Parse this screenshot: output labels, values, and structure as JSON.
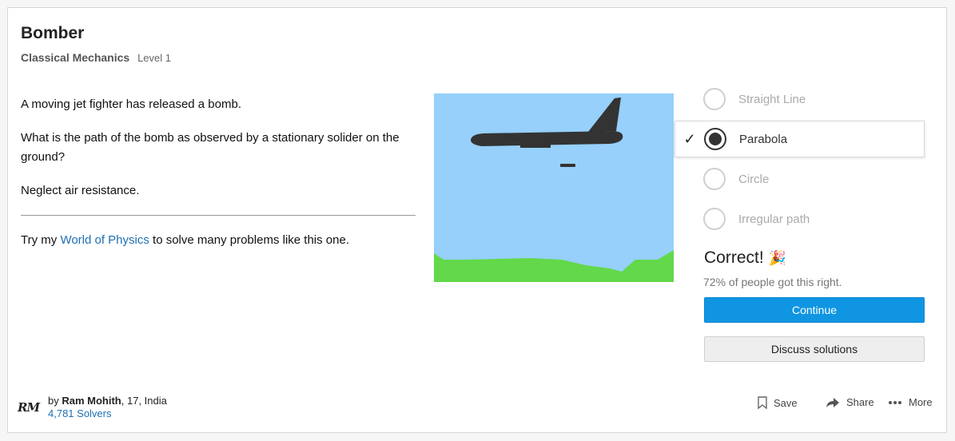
{
  "problem": {
    "title": "Bomber",
    "topic": "Classical Mechanics",
    "level": "Level 1",
    "paragraphs": [
      "A moving jet fighter has released a bomb.",
      "What is the path of the bomb as observed by a stationary solider on the ground?",
      "Neglect air resistance."
    ],
    "promo_before": "Try my ",
    "promo_link": "World of Physics",
    "promo_after": " to solve many problems like this one."
  },
  "options": [
    {
      "label": "Straight Line",
      "selected": false
    },
    {
      "label": "Parabola",
      "selected": true
    },
    {
      "label": "Circle",
      "selected": false
    },
    {
      "label": "Irregular path",
      "selected": false
    }
  ],
  "result": {
    "title": "Correct!",
    "emoji": "🎉",
    "stat": "72% of people got this right."
  },
  "buttons": {
    "continue": "Continue",
    "discuss": "Discuss solutions"
  },
  "author": {
    "logo": "RM",
    "by": "by ",
    "name": "Ram Mohith",
    "details": ", 17, India",
    "solvers": "4,781 Solvers"
  },
  "actions": {
    "save": "Save",
    "share": "Share",
    "more": "More"
  },
  "colors": {
    "sky": "#96d0fb",
    "ground": "#62d84a",
    "plane": "#333333",
    "accent": "#0f95e2",
    "link": "#1f6fb2"
  }
}
